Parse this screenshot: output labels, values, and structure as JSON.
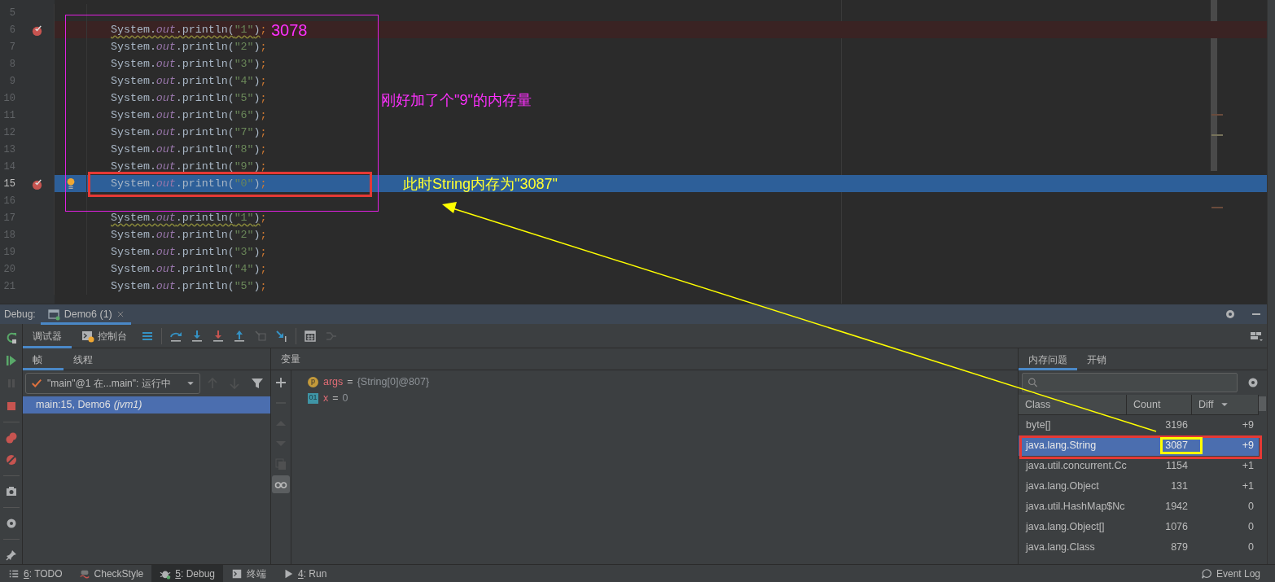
{
  "editor": {
    "lines": [
      {
        "number": "5",
        "breakpoint": false,
        "current": false
      },
      {
        "number": "6",
        "breakpoint": true,
        "current": false,
        "bulb": false,
        "warning": true,
        "code": [
          {
            "text": "System.",
            "kind": "plain"
          },
          {
            "text": "out",
            "kind": "field"
          },
          {
            "text": ".println(",
            "kind": "plain"
          },
          {
            "text": "\"1\"",
            "kind": "string"
          },
          {
            "text": ")",
            "kind": "plain"
          },
          {
            "text": ";",
            "kind": "keyword"
          }
        ]
      },
      {
        "number": "7",
        "breakpoint": false,
        "current": false,
        "bulb": false,
        "warning": false,
        "code": [
          {
            "text": "System.",
            "kind": "plain"
          },
          {
            "text": "out",
            "kind": "field"
          },
          {
            "text": ".println(",
            "kind": "plain"
          },
          {
            "text": "\"2\"",
            "kind": "string"
          },
          {
            "text": ")",
            "kind": "plain"
          },
          {
            "text": ";",
            "kind": "keyword"
          }
        ]
      },
      {
        "number": "8",
        "breakpoint": false,
        "current": false,
        "bulb": false,
        "warning": false,
        "code": [
          {
            "text": "System.",
            "kind": "plain"
          },
          {
            "text": "out",
            "kind": "field"
          },
          {
            "text": ".println(",
            "kind": "plain"
          },
          {
            "text": "\"3\"",
            "kind": "string"
          },
          {
            "text": ")",
            "kind": "plain"
          },
          {
            "text": ";",
            "kind": "keyword"
          }
        ]
      },
      {
        "number": "9",
        "breakpoint": false,
        "current": false,
        "bulb": false,
        "warning": false,
        "code": [
          {
            "text": "System.",
            "kind": "plain"
          },
          {
            "text": "out",
            "kind": "field"
          },
          {
            "text": ".println(",
            "kind": "plain"
          },
          {
            "text": "\"4\"",
            "kind": "string"
          },
          {
            "text": ")",
            "kind": "plain"
          },
          {
            "text": ";",
            "kind": "keyword"
          }
        ]
      },
      {
        "number": "10",
        "breakpoint": false,
        "current": false,
        "bulb": false,
        "warning": false,
        "code": [
          {
            "text": "System.",
            "kind": "plain"
          },
          {
            "text": "out",
            "kind": "field"
          },
          {
            "text": ".println(",
            "kind": "plain"
          },
          {
            "text": "\"5\"",
            "kind": "string"
          },
          {
            "text": ")",
            "kind": "plain"
          },
          {
            "text": ";",
            "kind": "keyword"
          }
        ]
      },
      {
        "number": "11",
        "breakpoint": false,
        "current": false,
        "bulb": false,
        "warning": false,
        "code": [
          {
            "text": "System.",
            "kind": "plain"
          },
          {
            "text": "out",
            "kind": "field"
          },
          {
            "text": ".println(",
            "kind": "plain"
          },
          {
            "text": "\"6\"",
            "kind": "string"
          },
          {
            "text": ")",
            "kind": "plain"
          },
          {
            "text": ";",
            "kind": "keyword"
          }
        ]
      },
      {
        "number": "12",
        "breakpoint": false,
        "current": false,
        "bulb": false,
        "warning": false,
        "code": [
          {
            "text": "System.",
            "kind": "plain"
          },
          {
            "text": "out",
            "kind": "field"
          },
          {
            "text": ".println(",
            "kind": "plain"
          },
          {
            "text": "\"7\"",
            "kind": "string"
          },
          {
            "text": ")",
            "kind": "plain"
          },
          {
            "text": ";",
            "kind": "keyword"
          }
        ]
      },
      {
        "number": "13",
        "breakpoint": false,
        "current": false,
        "bulb": false,
        "warning": false,
        "code": [
          {
            "text": "System.",
            "kind": "plain"
          },
          {
            "text": "out",
            "kind": "field"
          },
          {
            "text": ".println(",
            "kind": "plain"
          },
          {
            "text": "\"8\"",
            "kind": "string"
          },
          {
            "text": ")",
            "kind": "plain"
          },
          {
            "text": ";",
            "kind": "keyword"
          }
        ]
      },
      {
        "number": "14",
        "breakpoint": false,
        "current": false,
        "bulb": false,
        "warning": false,
        "code": [
          {
            "text": "System.",
            "kind": "plain"
          },
          {
            "text": "out",
            "kind": "field"
          },
          {
            "text": ".println(",
            "kind": "plain"
          },
          {
            "text": "\"9\"",
            "kind": "string"
          },
          {
            "text": ")",
            "kind": "plain"
          },
          {
            "text": ";",
            "kind": "keyword"
          }
        ]
      },
      {
        "number": "15",
        "breakpoint": true,
        "current": true,
        "bulb": true,
        "warning": false,
        "code": [
          {
            "text": "System.",
            "kind": "plain"
          },
          {
            "text": "out",
            "kind": "field"
          },
          {
            "text": ".println(",
            "kind": "plain"
          },
          {
            "text": "\"0\"",
            "kind": "string"
          },
          {
            "text": ")",
            "kind": "plain"
          },
          {
            "text": ";",
            "kind": "keyword"
          }
        ]
      },
      {
        "number": "16",
        "breakpoint": false,
        "current": false
      },
      {
        "number": "17",
        "breakpoint": false,
        "current": false,
        "bulb": false,
        "warning": true,
        "code": [
          {
            "text": "System.",
            "kind": "plain"
          },
          {
            "text": "out",
            "kind": "field"
          },
          {
            "text": ".println(",
            "kind": "plain"
          },
          {
            "text": "\"1\"",
            "kind": "string"
          },
          {
            "text": ")",
            "kind": "plain"
          },
          {
            "text": ";",
            "kind": "keyword"
          }
        ]
      },
      {
        "number": "18",
        "breakpoint": false,
        "current": false,
        "bulb": false,
        "warning": false,
        "code": [
          {
            "text": "System.",
            "kind": "plain"
          },
          {
            "text": "out",
            "kind": "field"
          },
          {
            "text": ".println(",
            "kind": "plain"
          },
          {
            "text": "\"2\"",
            "kind": "string"
          },
          {
            "text": ")",
            "kind": "plain"
          },
          {
            "text": ";",
            "kind": "keyword"
          }
        ]
      },
      {
        "number": "19",
        "breakpoint": false,
        "current": false,
        "bulb": false,
        "warning": false,
        "code": [
          {
            "text": "System.",
            "kind": "plain"
          },
          {
            "text": "out",
            "kind": "field"
          },
          {
            "text": ".println(",
            "kind": "plain"
          },
          {
            "text": "\"3\"",
            "kind": "string"
          },
          {
            "text": ")",
            "kind": "plain"
          },
          {
            "text": ";",
            "kind": "keyword"
          }
        ]
      },
      {
        "number": "20",
        "breakpoint": false,
        "current": false,
        "bulb": false,
        "warning": false,
        "code": [
          {
            "text": "System.",
            "kind": "plain"
          },
          {
            "text": "out",
            "kind": "field"
          },
          {
            "text": ".println(",
            "kind": "plain"
          },
          {
            "text": "\"4\"",
            "kind": "string"
          },
          {
            "text": ")",
            "kind": "plain"
          },
          {
            "text": ";",
            "kind": "keyword"
          }
        ]
      },
      {
        "number": "21",
        "breakpoint": false,
        "current": false,
        "bulb": false,
        "warning": false,
        "code": [
          {
            "text": "System.",
            "kind": "plain"
          },
          {
            "text": "out",
            "kind": "field"
          },
          {
            "text": ".println(",
            "kind": "plain"
          },
          {
            "text": "\"5\"",
            "kind": "string"
          },
          {
            "text": ")",
            "kind": "plain"
          },
          {
            "text": ";",
            "kind": "keyword"
          }
        ]
      }
    ]
  },
  "debug": {
    "title": "Debug:",
    "sessions": [
      {
        "label": "Demo6 (1)",
        "selected": true
      }
    ],
    "tabs": [
      {
        "label": "调试器",
        "selected": true
      },
      {
        "label": "控制台",
        "selected": false
      }
    ],
    "frame_tabs": [
      {
        "label": "帧",
        "selected": true
      },
      {
        "label": "线程",
        "selected": false
      }
    ],
    "thread": "\"main\"@1 在...main\": 运行中",
    "frames": [
      {
        "text": "main:15, Demo6 *(jvm1)*",
        "selected": true
      }
    ],
    "variables_title": "变量",
    "variables": [
      {
        "badge": "p",
        "kind": "param",
        "name": "args",
        "operator": "=",
        "value": "{String[0]@807}"
      },
      {
        "badge": "01",
        "kind": "local",
        "name": "x",
        "operator": "=",
        "value": "0"
      }
    ],
    "memory": {
      "tabs": [
        {
          "label": "内存问题",
          "selected": true
        },
        {
          "label": "开销",
          "selected": false
        }
      ],
      "columns": [
        "Class",
        "Count",
        "Diff"
      ],
      "rows": [
        {
          "class": "byte[]",
          "count": "3196",
          "diff": "+9",
          "selected": false
        },
        {
          "class": "java.lang.String",
          "count": "3087",
          "diff": "+9",
          "selected": true
        },
        {
          "class": "java.util.concurrent.Cc",
          "count": "1154",
          "diff": "+1",
          "selected": false
        },
        {
          "class": "java.lang.Object",
          "count": "131",
          "diff": "+1",
          "selected": false
        },
        {
          "class": "java.util.HashMap$Nc",
          "count": "1942",
          "diff": "0",
          "selected": false
        },
        {
          "class": "java.lang.Object[]",
          "count": "1076",
          "diff": "0",
          "selected": false
        },
        {
          "class": "java.lang.Class",
          "count": "879",
          "diff": "0",
          "selected": false
        }
      ]
    }
  },
  "status_bar": {
    "items": [
      {
        "key": "6",
        "label": ": TODO",
        "kind": "list",
        "selected": false
      },
      {
        "label": "CheckStyle",
        "kind": "checkstyle",
        "selected": false
      },
      {
        "key": "5",
        "label": ": Debug",
        "kind": "bug",
        "selected": true
      },
      {
        "label": "终端",
        "kind": "terminal",
        "selected": false
      },
      {
        "key": "4",
        "label": ": Run",
        "kind": "run",
        "selected": false
      }
    ],
    "event_log": "Event Log"
  },
  "annotations": {
    "count_label": "3078",
    "note": "刚好加了个\"9\"的内存量",
    "callout": "此时String内存为\"3087\""
  }
}
